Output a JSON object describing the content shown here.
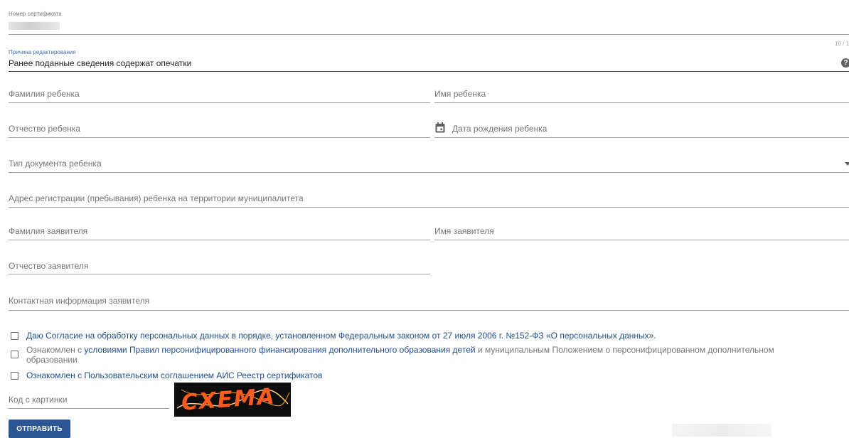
{
  "certificate": {
    "label": "Номер сертификата",
    "value": ""
  },
  "reason": {
    "label": "Причина редактирования",
    "value": "Ранее поданные сведения содержат опечатки",
    "counter": "10 / 1"
  },
  "child": {
    "last_name": "Фамилия ребенка",
    "first_name": "Имя ребенка",
    "patronymic": "Отчество ребенка",
    "birth_date": "Дата рождения ребенка",
    "doc_type": "Тип документа ребенка",
    "address": "Адрес регистрации (пребывания) ребенка на территории муниципалитета"
  },
  "applicant": {
    "last_name": "Фамилия заявителя",
    "first_name": "Имя заявителя",
    "patronymic": "Отчество заявителя",
    "contact": "Контактная информация заявителя"
  },
  "agreements": {
    "consent": "Даю Согласие на обработку персональных данных в порядке, установленном Федеральным законом от 27 июля 2006 г. №152-ФЗ «О персональных данных».",
    "rules_prefix": "Ознакомлен с ",
    "rules_link_1": "условиями",
    "rules_link_2": "Правил персонифицированного финансирования дополнительного образования детей",
    "rules_suffix": " и муниципальным Положением о персонифицированном дополнительном образовании",
    "user_agreement": "Ознакомлен с Пользовательским соглашением АИС Реестр сертификатов"
  },
  "captcha": {
    "label": "Код с картинки",
    "image_text": "CXEMA"
  },
  "submit_label": "ОТПРАВИТЬ",
  "colors": {
    "link": "#1f4f8f",
    "label_accent": "#3f6fb0",
    "button": "#2b5797"
  }
}
